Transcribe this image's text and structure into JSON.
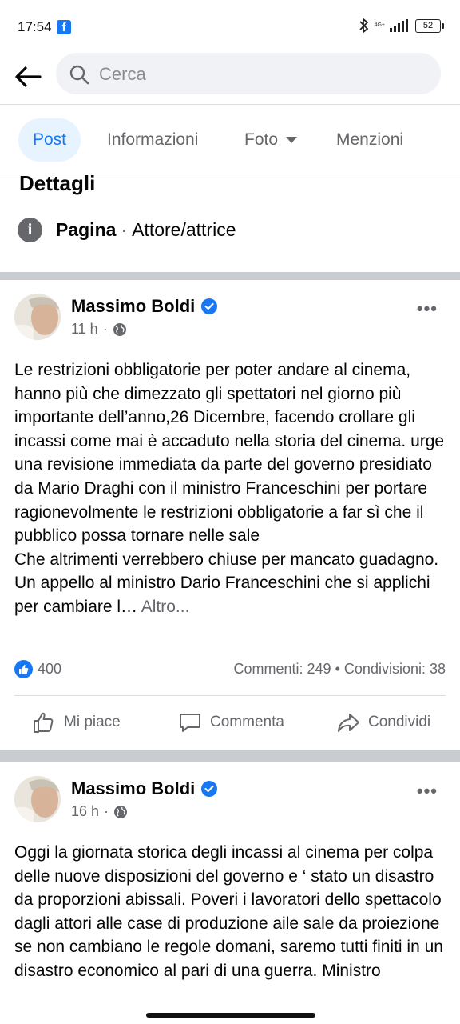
{
  "status_bar": {
    "time": "17:54",
    "battery": "52",
    "network": "4G+"
  },
  "search": {
    "placeholder": "Cerca"
  },
  "tabs": [
    {
      "label": "Post",
      "active": true
    },
    {
      "label": "Informazioni"
    },
    {
      "label": "Foto"
    },
    {
      "label": "Menzioni"
    }
  ],
  "details": {
    "title": "Dettagli",
    "page_label": "Pagina",
    "separator": "·",
    "category": "Attore/attrice"
  },
  "posts": [
    {
      "author": "Massimo Boldi",
      "time": "11 h",
      "dot": "·",
      "text": "Le restrizioni obbligatorie per poter andare al cinema, hanno più che dimezzato gli spettatori nel giorno più importante dell’anno,26 Dicembre, facendo crollare gli incassi come mai è accaduto nella storia del cinema. urge una revisione immediata da parte del governo presidiato da Mario Draghi con il ministro Franceschini per portare ragionevolmente le restrizioni obbligatorie a far sì che il pubblico possa tornare nelle sale",
      "text2": "Che altrimenti verrebbero chiuse per mancato guadagno. Un appello al ministro Dario Franceschini che si applichi per cambiare l…",
      "more_link": "Altro...",
      "likes": "400",
      "comments": "Commenti: 249",
      "bullet": "•",
      "shares": "Condivisioni: 38",
      "actions": {
        "like": "Mi piace",
        "comment": "Commenta",
        "share": "Condividi"
      }
    },
    {
      "author": "Massimo Boldi",
      "time": "16 h",
      "dot": "·",
      "text": "Oggi la giornata storica degli incassi al cinema per colpa delle nuove disposizioni del governo e ‘ stato un disastro da proporzioni abissali. Poveri i lavoratori dello spettacolo dagli attori alle case di produzione aile sale da proiezione se non cambiano le regole domani, saremo tutti finiti in un disastro economico al pari di una guerra. Ministro"
    }
  ],
  "colors": {
    "accent": "#1877f2",
    "divider": "#c9ccd1",
    "secondary_text": "#65676b"
  }
}
